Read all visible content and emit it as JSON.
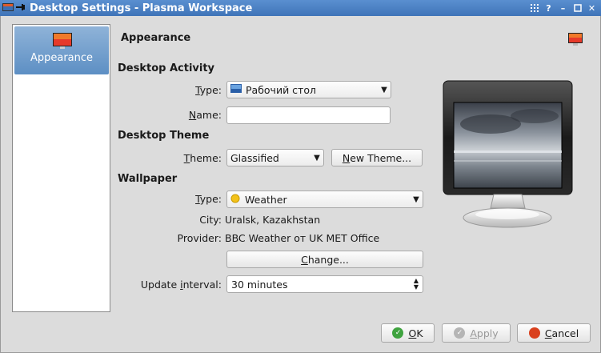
{
  "titlebar": {
    "title": "Desktop Settings - Plasma Workspace"
  },
  "sidebar": {
    "items": [
      {
        "label": "Appearance"
      }
    ]
  },
  "page": {
    "title": "Appearance"
  },
  "activity": {
    "heading": "Desktop Activity",
    "type_label_a": "T",
    "type_label_b": "ype:",
    "type_value": "Рабочий стол",
    "name_label_a": "N",
    "name_label_b": "ame:",
    "name_value": ""
  },
  "theme": {
    "heading": "Desktop Theme",
    "theme_label_a": "T",
    "theme_label_b": "heme:",
    "theme_value": "Glassified",
    "new_theme_a": "N",
    "new_theme_b": "ew Theme..."
  },
  "wallpaper": {
    "heading": "Wallpaper",
    "type_label_a": "T",
    "type_label_b": "ype:",
    "type_value": "Weather",
    "city_label": "City:",
    "city_value": "Uralsk, Kazakhstan",
    "provider_label": "Provider:",
    "provider_value": "BBC Weather от UK MET Office",
    "change_a": "C",
    "change_b": "hange...",
    "interval_label_a": "Update ",
    "interval_label_b": "i",
    "interval_label_c": "nterval:",
    "interval_value": "30 minutes"
  },
  "buttons": {
    "ok_a": "O",
    "ok_b": "K",
    "apply_a": "A",
    "apply_b": "pply",
    "cancel_a": "C",
    "cancel_b": "ancel"
  },
  "colors": {
    "titlebar": "#4a80c4",
    "selection": "#6b98c9",
    "ok": "#3fa33f",
    "cancel": "#d9411e"
  }
}
